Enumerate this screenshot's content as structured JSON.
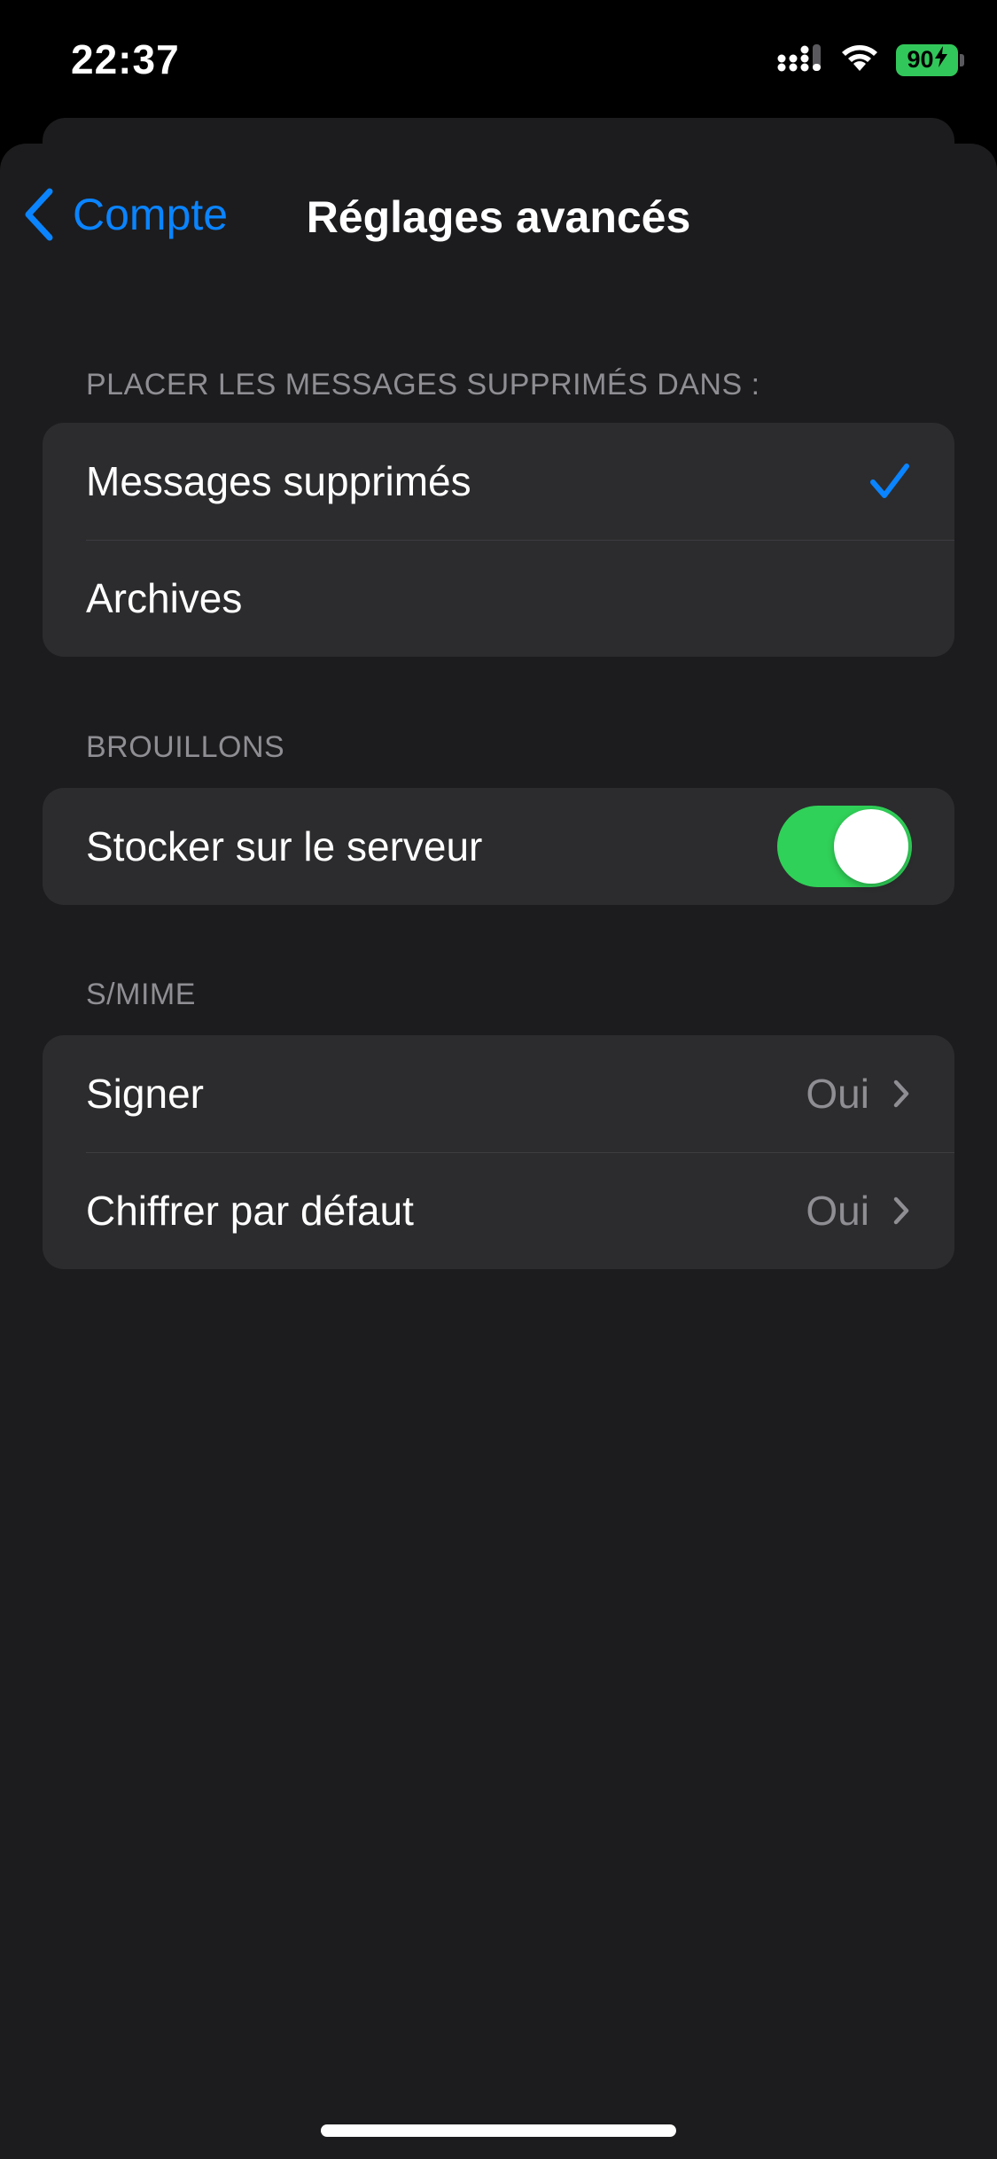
{
  "status_bar": {
    "time": "22:37",
    "battery_level": "90",
    "battery_charging": true,
    "icons": [
      "cellular-signal-icon",
      "wifi-icon",
      "battery-icon",
      "bolt-icon"
    ]
  },
  "nav": {
    "back_label": "Compte",
    "title": "Réglages avancés"
  },
  "sections": {
    "deleted": {
      "header": "PLACER LES MESSAGES SUPPRIMÉS DANS :",
      "items": [
        {
          "label": "Messages supprimés",
          "selected": true
        },
        {
          "label": "Archives",
          "selected": false
        }
      ]
    },
    "drafts": {
      "header": "BROUILLONS",
      "items": [
        {
          "label": "Stocker sur le serveur",
          "toggle_on": true
        }
      ]
    },
    "smime": {
      "header": "S/MIME",
      "items": [
        {
          "label": "Signer",
          "value": "Oui"
        },
        {
          "label": "Chiffrer par défaut",
          "value": "Oui"
        }
      ]
    }
  },
  "colors": {
    "accent": "#0a84ff",
    "toggle_on": "#30d158",
    "battery": "#32c75a",
    "background": "#1c1c1e",
    "cell": "#2c2c2e",
    "secondary_text": "#8e8e93"
  }
}
